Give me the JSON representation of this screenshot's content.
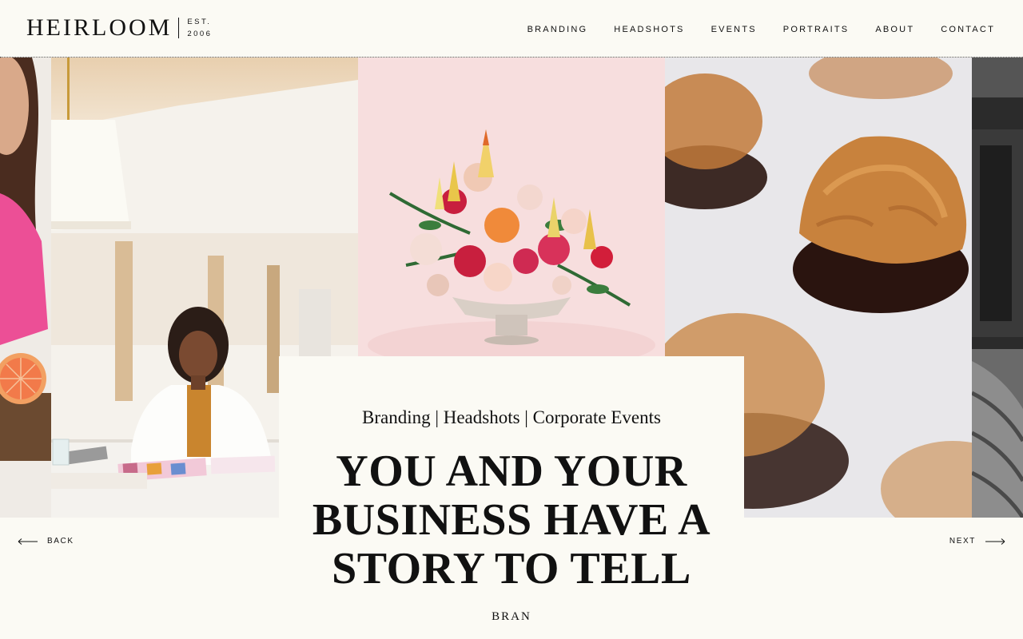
{
  "brand": {
    "name": "HEIRLOOM",
    "est_line1": "EST.",
    "est_line2": "2006"
  },
  "nav": {
    "items": [
      {
        "label": "BRANDING"
      },
      {
        "label": "HEADSHOTS"
      },
      {
        "label": "EVENTS"
      },
      {
        "label": "PORTRAITS"
      },
      {
        "label": "ABOUT"
      },
      {
        "label": "CONTACT"
      }
    ]
  },
  "gallery": {
    "images": [
      {
        "icon": "woman-pink-shirt-grapefruit-photo"
      },
      {
        "icon": "woman-working-at-desk-photo"
      },
      {
        "icon": "flower-arrangement-vase-photo"
      },
      {
        "icon": "chocolate-dipped-macaroons-photo"
      },
      {
        "icon": "wine-barrels-bw-photo"
      }
    ]
  },
  "hero": {
    "services": "Branding | Headshots | Corporate Events",
    "headline_line1": "YOU AND YOUR",
    "headline_line2": "BUSINESS HAVE A",
    "headline_line3": "STORY TO TELL",
    "sub_label": "BRAN"
  },
  "carousel": {
    "back_label": "BACK",
    "next_label": "NEXT"
  },
  "colors": {
    "background": "#fbfaf4",
    "text": "#111111",
    "pink_backdrop": "#f6dcdc",
    "accent_pink": "#e8478f"
  }
}
